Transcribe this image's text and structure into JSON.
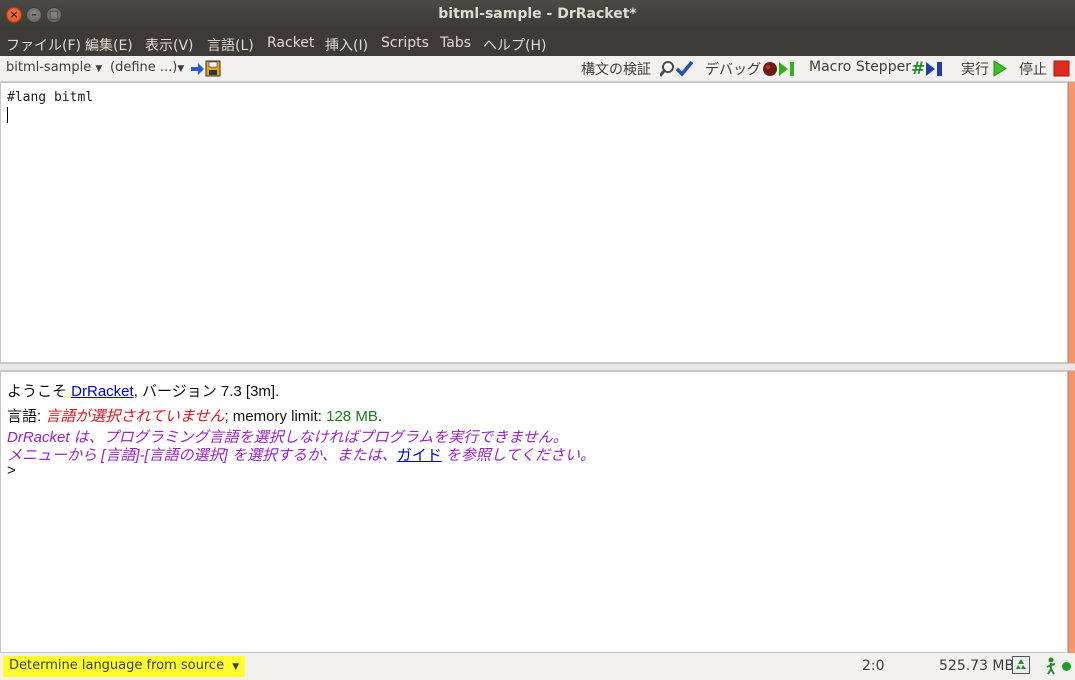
{
  "window": {
    "title": "bitml-sample - DrRacket*"
  },
  "menubar": [
    {
      "label": "ファイル(F)"
    },
    {
      "label": "編集(E)"
    },
    {
      "label": "表示(V)"
    },
    {
      "label": "言語(L)"
    },
    {
      "label": "Racket"
    },
    {
      "label": "挿入(I)"
    },
    {
      "label": "Scripts"
    },
    {
      "label": "Tabs"
    },
    {
      "label": "ヘルプ(H)"
    }
  ],
  "toolbar": {
    "file_dropdown": "bitml-sample",
    "define_dropdown": "(define ...)",
    "check_syntax": "構文の検証",
    "debug": "デバッグ",
    "macro_stepper": "Macro Stepper",
    "run": "実行",
    "stop": "停止"
  },
  "editor": {
    "code_line1": "#lang bitml"
  },
  "repl": {
    "welcome_prefix": "ようこそ ",
    "welcome_link": "DrRacket",
    "welcome_suffix": ", バージョン 7.3 [3m].",
    "lang_prefix": "言語: ",
    "lang_error": "言語が選択されていません",
    "lang_mem_prefix": "; memory limit: ",
    "lang_mem_value": "128 MB",
    "lang_mem_suffix": ".",
    "msg_line1": "DrRacket は、プログラミング言語を選択しなければプログラムを実行できません。",
    "msg_line2_prefix": "メニューから [言語]-[言語の選択] を選択するか、または、",
    "msg_line2_link": "ガイド",
    "msg_line2_suffix": " を参照してください。",
    "prompt": ">"
  },
  "statusbar": {
    "language": "Determine language from source",
    "position": "2:0",
    "memory": "525.73 MB"
  },
  "colors": {
    "language_highlight": "#ffff2e",
    "error_text": "#e0141e",
    "message_text": "#9a22c8",
    "link": "#0000cc"
  }
}
